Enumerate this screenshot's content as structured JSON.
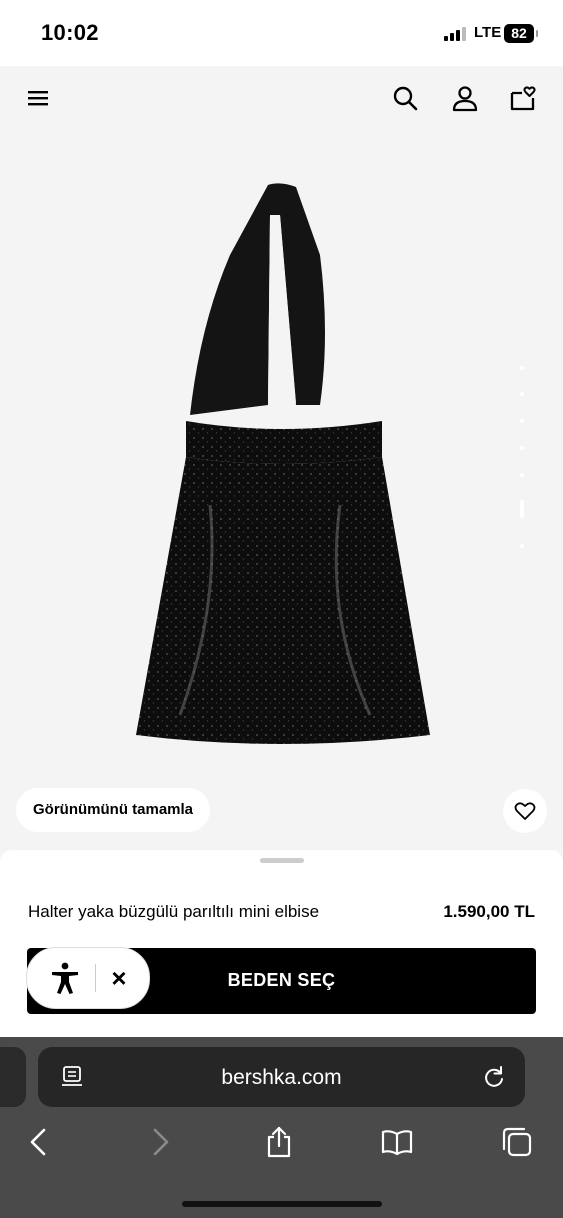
{
  "status": {
    "time": "10:02",
    "network": "LTE",
    "battery": "82"
  },
  "header": {
    "icons": [
      "menu-icon",
      "search-icon",
      "account-icon",
      "wishlist-bag-icon"
    ]
  },
  "product": {
    "name": "Halter yaka büzgülü parıltılı mini elbise",
    "price": "1.590,00 TL",
    "image": "black-sequin-halter-mini-dress"
  },
  "actions": {
    "complete_look": "Görünümünü tamamla",
    "size_button": "BEDEN SEÇ"
  },
  "accessibility": {
    "close_label": "×"
  },
  "browser": {
    "url": "bershka.com",
    "icons": [
      "reader-icon",
      "reload-icon",
      "back-icon",
      "forward-icon",
      "share-icon",
      "bookmarks-icon",
      "tabs-icon"
    ]
  },
  "colors": {
    "accent": "#000000",
    "background": "#f4f4f4",
    "toolbar": "#4a4a4a"
  }
}
